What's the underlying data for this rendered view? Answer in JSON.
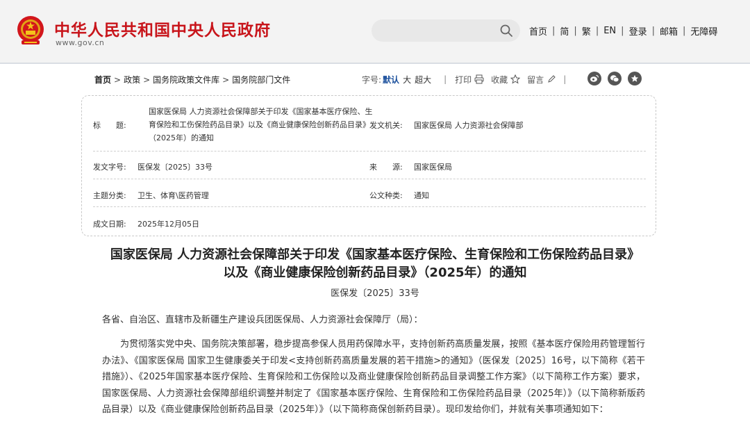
{
  "header": {
    "site_title": "中华人民共和国中央人民政府",
    "site_url": "www.gov.cn",
    "nav": [
      "首页",
      "简",
      "繁",
      "EN",
      "登录",
      "邮箱",
      "无障碍"
    ],
    "nav_separator": "|"
  },
  "breadcrumb": {
    "items": [
      "首页",
      "政策",
      "国务院政策文件库",
      "国务院部门文件"
    ],
    "arrow": ">"
  },
  "toolbar": {
    "font_size_label": "字号:",
    "font_sizes": [
      "默认",
      "大",
      "超大"
    ],
    "divider": "|",
    "print_label": "打印",
    "favorite_label": "收藏",
    "comment_label": "留言"
  },
  "info": {
    "title_label": "标　　题:",
    "title_value": "国家医保局 人力资源社会保障部关于印发《国家基本医疗保险、生育保险和工伤保险药品目录》以及《商业健康保险创新药品目录》（2025年）的通知",
    "issuer_label": "发文机关:",
    "issuer_value": "国家医保局 人力资源社会保障部",
    "doc_no_label": "发文字号:",
    "doc_no_value": "医保发〔2025〕33号",
    "source_label": "来　　源:",
    "source_value": "国家医保局",
    "topic_label": "主题分类:",
    "topic_value": "卫生、体育\\医药管理",
    "type_label": "公文种类:",
    "type_value": "通知",
    "date_label": "成文日期:",
    "date_value": "2025年12月05日"
  },
  "document": {
    "title": "国家医保局 人力资源社会保障部关于印发《国家基本医疗保险、生育保险和工伤保险药品目录》以及《商业健康保险创新药品目录》（2025年）的通知",
    "number": "医保发〔2025〕33号",
    "salutation": "各省、自治区、直辖市及新疆生产建设兵团医保局、人力资源社会保障厅（局）：",
    "paragraph": "为贯彻落实党中央、国务院决策部署，稳步提高参保人员用药保障水平，支持创新药高质量发展，按照《基本医疗保险用药管理暂行办法》、《国家医保局 国家卫生健康委关于印发<支持创新药高质量发展的若干措施>的通知》（医保发〔2025〕16号，以下简称《若干措施》）、《2025年国家基本医疗保险、生育保险和工伤保险以及商业健康保险创新药品目录调整工作方案》（以下简称工作方案）要求，国家医保局、人力资源社会保障部组织调整并制定了《国家基本医疗保险、生育保险和工伤保险药品目录（2025年）》（以下简称新版药品目录）以及《商业健康保险创新药品目录（2025年）》（以下简称商保创新药目录）。现印发给你们，并就有关事项通知如下："
  },
  "colors": {
    "brand_red": "#c8151b",
    "accent_blue": "#1a4f9c"
  }
}
